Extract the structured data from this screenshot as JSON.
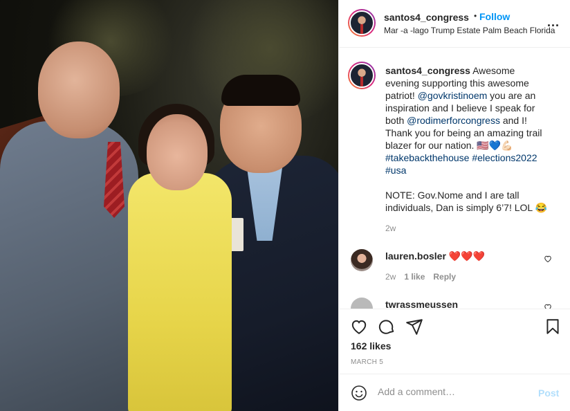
{
  "post": {
    "username": "santos4_congress",
    "follow_label": "Follow",
    "dot": "•",
    "location": "Mar -a -lago Trump Estate Palm Beach Florida",
    "more_label": "..."
  },
  "caption": {
    "username": "santos4_congress",
    "part1": " Awesome evening supporting this awesome patriot! ",
    "mention1": "@govkristinoem",
    "part2": " you are an inspiration and I believe I speak for both ",
    "mention2": "@rodimerforcongress",
    "part3": " and I! Thank you for being an amazing trail blazer for our nation. 🇺🇸💙💪🏻",
    "hashtag1": "#takebackthehouse",
    "hashtag2": "#elections2022",
    "hashtag3": "#usa",
    "note": "NOTE: Gov.Nome and I are tall individuals, Dan is simply 6’7! LOL 😂",
    "time": "2w"
  },
  "comments": [
    {
      "username": "lauren.bosler",
      "text": "❤️❤️❤️",
      "time": "2w",
      "likes": "1 like",
      "reply_label": "Reply"
    },
    {
      "username": "twrassmeussen"
    }
  ],
  "actions": {
    "icons": [
      "heart-icon",
      "comment-icon",
      "share-icon",
      "bookmark-icon"
    ],
    "likes": "162 likes",
    "date": "MARCH 5"
  },
  "add_comment": {
    "placeholder": "Add a comment…",
    "post_label": "Post"
  },
  "colors": {
    "link": "#00376b",
    "follow": "#0095f6",
    "post_disabled": "#b2dffc",
    "meta": "#8e8e8e"
  }
}
